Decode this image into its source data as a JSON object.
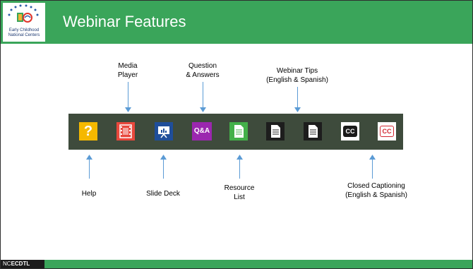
{
  "slide": {
    "title": "Webinar Features",
    "logo_text": "Early Childhood\nNational Centers"
  },
  "labels": {
    "media_player": "Media\nPlayer",
    "question_answers": "Question\n& Answers",
    "webinar_tips": "Webinar Tips\n(English & Spanish)",
    "help": "Help",
    "slide_deck": "Slide Deck",
    "resource_list": "Resource\nList",
    "closed_captioning": "Closed Captioning\n(English & Spanish)"
  },
  "toolbar": {
    "help_glyph": "?",
    "qa_glyph": "Q&A",
    "cc_glyph": "CC",
    "cc_es_glyph": "CC"
  },
  "footer": {
    "brand_prefix": "NC",
    "brand_bold": "ECDTL"
  }
}
